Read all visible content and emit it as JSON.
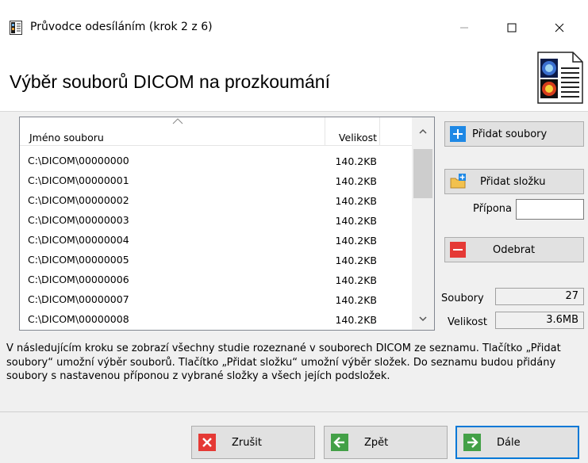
{
  "window": {
    "title": "Průvodce odesíláním (krok 2 z 6)",
    "controls": {
      "minimize": "—",
      "maximize": "☐",
      "close": "✕"
    }
  },
  "header": {
    "title": "Výběr souborů DICOM na prozkoumání"
  },
  "file_list": {
    "columns": {
      "name": "Jméno souboru",
      "size": "Velikost"
    },
    "rows": [
      {
        "name": "C:\\DICOM\\00000000",
        "size": "140.2KB"
      },
      {
        "name": "C:\\DICOM\\00000001",
        "size": "140.2KB"
      },
      {
        "name": "C:\\DICOM\\00000002",
        "size": "140.2KB"
      },
      {
        "name": "C:\\DICOM\\00000003",
        "size": "140.2KB"
      },
      {
        "name": "C:\\DICOM\\00000004",
        "size": "140.2KB"
      },
      {
        "name": "C:\\DICOM\\00000005",
        "size": "140.2KB"
      },
      {
        "name": "C:\\DICOM\\00000006",
        "size": "140.2KB"
      },
      {
        "name": "C:\\DICOM\\00000007",
        "size": "140.2KB"
      },
      {
        "name": "C:\\DICOM\\00000008",
        "size": "140.2KB"
      }
    ]
  },
  "actions": {
    "add_files": "Přidat soubory",
    "add_folder": "Přidat složku",
    "extension_label": "Přípona",
    "extension_value": "",
    "remove": "Odebrat"
  },
  "stats": {
    "files_label": "Soubory",
    "files_value": "27",
    "size_label": "Velikost",
    "size_value": "3.6MB"
  },
  "description": "V následujícím kroku se zobrazí všechny studie rozeznané v souborech DICOM ze seznamu. Tlačítko „Přidat soubory“ umožní výběr souborů. Tlačítko „Přidat složku“ umožní výběr složek. Do seznamu budou přidány soubory s nastavenou příponou z vybrané složky a všech jejích podsložek.",
  "footer": {
    "cancel": "Zrušit",
    "back": "Zpět",
    "next": "Dále"
  },
  "colors": {
    "accent_blue": "#0078d7",
    "add_blue": "#1e88e5",
    "remove_red": "#e53935",
    "back_green": "#43a047",
    "folder_yellow": "#f2c14e"
  },
  "icons": {
    "app": "wizard-app-icon",
    "header": "dicom-document-icon",
    "add_files": "plus-icon",
    "add_folder": "folder-add-icon",
    "remove": "minus-icon",
    "cancel": "x-icon",
    "back": "arrow-left-icon",
    "next": "arrow-right-icon"
  }
}
